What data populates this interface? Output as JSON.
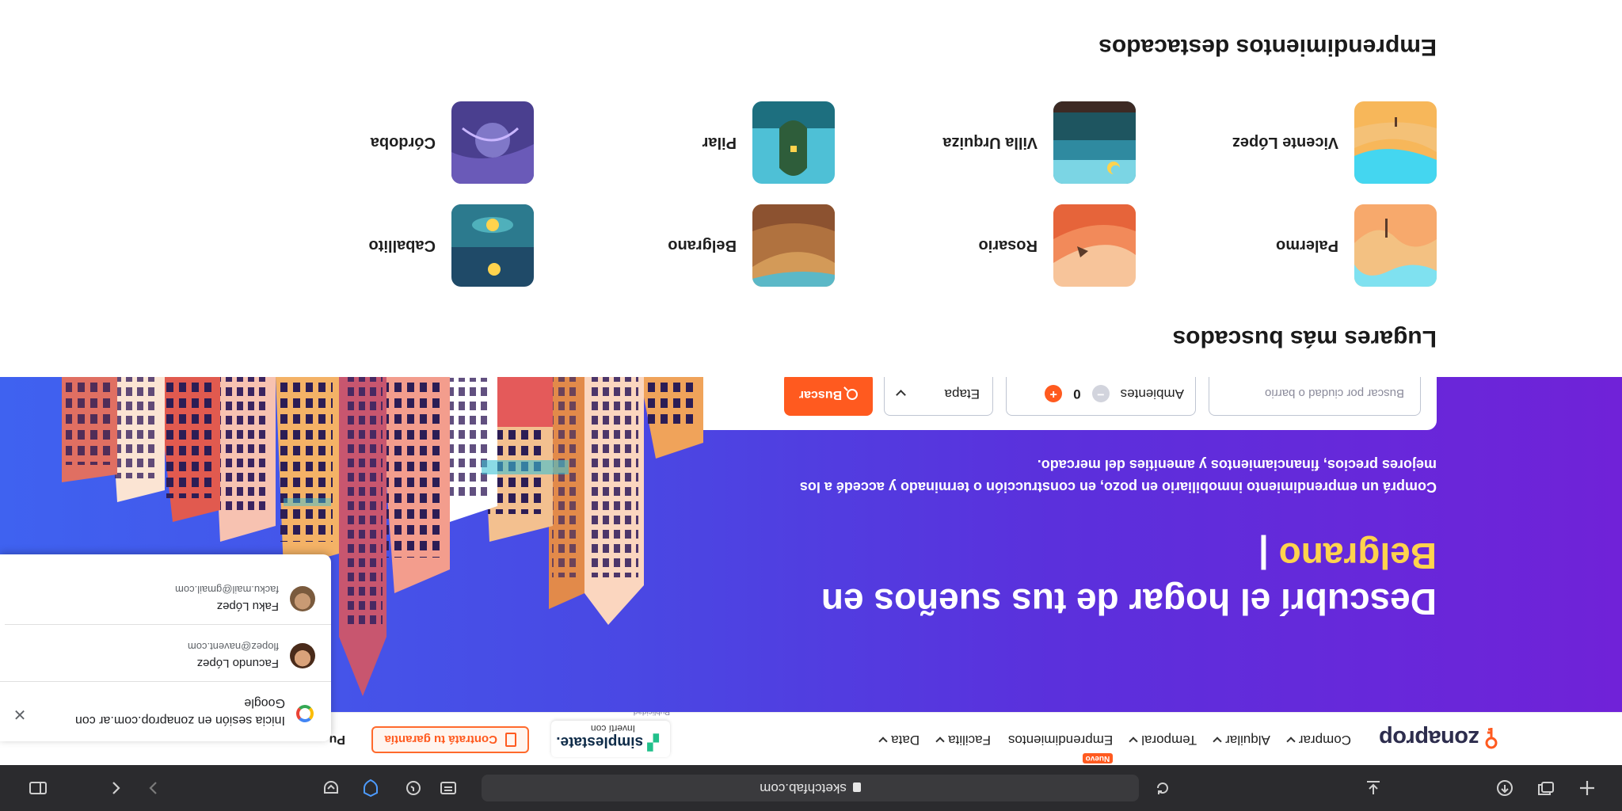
{
  "browser": {
    "url": "sketchfab.com"
  },
  "header": {
    "logo": "zonaprop",
    "nav": [
      {
        "label": "Comprar",
        "chevron": true
      },
      {
        "label": "Alquilar",
        "chevron": true
      },
      {
        "label": "Temporal",
        "chevron": true
      },
      {
        "label": "Emprendimientos",
        "chevron": false,
        "badge": "Nuevo"
      },
      {
        "label": "Facilita",
        "chevron": true
      },
      {
        "label": "Data",
        "chevron": true
      }
    ],
    "ad": {
      "brand": "simplestate.",
      "tagline": "Invertí con",
      "label": "Publicidad"
    },
    "garantia_button": "Contratá tu garantía",
    "publicar_partial": "Pu"
  },
  "hero": {
    "title_line1": "Descubrí el hogar de tus sueños en",
    "title_highlight": "Belgrano",
    "cursor": "|",
    "subtitle": "Comprá un emprendimiento inmobiliario en pozo, en construcción o terminado y accedé a los mejores precios, financiamientos y amenities del mercado.",
    "search": {
      "placeholder": "Buscar por ciudad o barrio",
      "ambientes_label": "Ambientes",
      "ambientes_value": "0",
      "etapa_label": "Etapa",
      "buscar_button": "Buscar"
    }
  },
  "google_popup": {
    "title": "Inicia sesión en zonaprop.com.ar con Google",
    "accounts": [
      {
        "name": "Facundo López",
        "email": "flopez@navent.com"
      },
      {
        "name": "Faku López",
        "email": "facku.mail@gmail.com"
      }
    ]
  },
  "lugares": {
    "title": "Lugares más buscados",
    "items": [
      "Palermo",
      "Rosario",
      "Belgrano",
      "Caballito"
    ]
  },
  "emprendimientos": {
    "title": "Emprendimientos destacados",
    "items": [
      "Vicente López",
      "Villa Urquiza",
      "Pilar",
      "Córdoba"
    ]
  },
  "colors": {
    "accent": "#ff5a1f",
    "highlight": "#ffd34d",
    "hero_gradient_start": "#7022d8",
    "hero_gradient_end": "#3f62f0"
  }
}
